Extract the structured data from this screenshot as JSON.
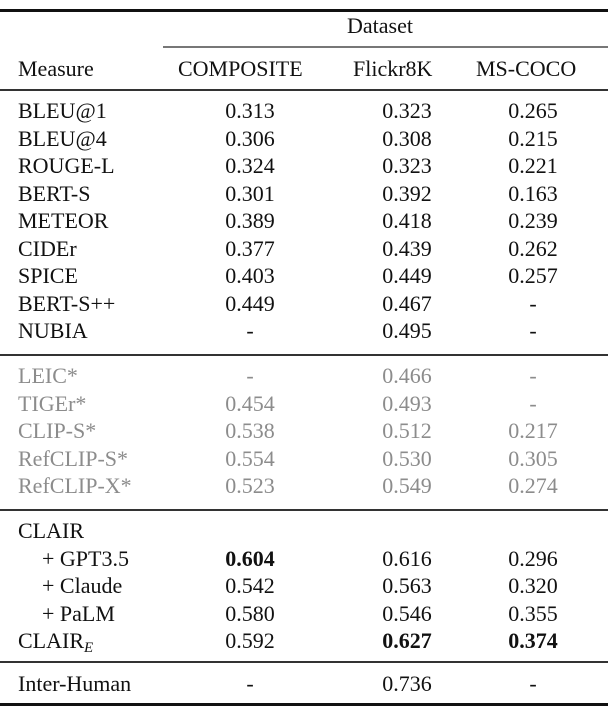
{
  "header": {
    "group_label": "Dataset",
    "measure_label": "Measure",
    "columns": [
      "COMPOSITE",
      "Flickr8K",
      "MS-COCO"
    ]
  },
  "sections": [
    {
      "name": "classic-metrics",
      "style": "normal",
      "rows": [
        {
          "measure": "BLEU@1",
          "values": [
            "0.313",
            "0.323",
            "0.265"
          ]
        },
        {
          "measure": "BLEU@4",
          "values": [
            "0.306",
            "0.308",
            "0.215"
          ]
        },
        {
          "measure": "ROUGE-L",
          "values": [
            "0.324",
            "0.323",
            "0.221"
          ]
        },
        {
          "measure": "BERT-S",
          "values": [
            "0.301",
            "0.392",
            "0.163"
          ]
        },
        {
          "measure": "METEOR",
          "values": [
            "0.389",
            "0.418",
            "0.239"
          ]
        },
        {
          "measure": "CIDEr",
          "values": [
            "0.377",
            "0.439",
            "0.262"
          ]
        },
        {
          "measure": "SPICE",
          "values": [
            "0.403",
            "0.449",
            "0.257"
          ]
        },
        {
          "measure": "BERT-S++",
          "values": [
            "0.449",
            "0.467",
            "-"
          ]
        },
        {
          "measure": "NUBIA",
          "values": [
            "-",
            "0.495",
            "-"
          ]
        }
      ]
    },
    {
      "name": "trained-metrics",
      "style": "gray",
      "rows": [
        {
          "measure": "LEIC*",
          "values": [
            "-",
            "0.466",
            "-"
          ]
        },
        {
          "measure": "TIGEr*",
          "values": [
            "0.454",
            "0.493",
            "-"
          ]
        },
        {
          "measure": "CLIP-S*",
          "values": [
            "0.538",
            "0.512",
            "0.217"
          ]
        },
        {
          "measure": "RefCLIP-S*",
          "values": [
            "0.554",
            "0.530",
            "0.305"
          ]
        },
        {
          "measure": "RefCLIP-X*",
          "values": [
            "0.523",
            "0.549",
            "0.274"
          ]
        }
      ]
    },
    {
      "name": "clair",
      "style": "normal",
      "rows": [
        {
          "measure": "CLAIR",
          "values": [
            "",
            "",
            ""
          ]
        },
        {
          "measure": "+ GPT3.5",
          "indent": true,
          "values": [
            "0.604",
            "0.616",
            "0.296"
          ],
          "bold": [
            true,
            false,
            false
          ]
        },
        {
          "measure": "+ Claude",
          "indent": true,
          "values": [
            "0.542",
            "0.563",
            "0.320"
          ]
        },
        {
          "measure": "+ PaLM",
          "indent": true,
          "values": [
            "0.580",
            "0.546",
            "0.355"
          ]
        },
        {
          "measure": "CLAIR",
          "subscript": "E",
          "values": [
            "0.592",
            "0.627",
            "0.374"
          ],
          "bold": [
            false,
            true,
            true
          ]
        }
      ]
    },
    {
      "name": "human",
      "style": "normal",
      "rows": [
        {
          "measure": "Inter-Human",
          "values": [
            "-",
            "0.736",
            "-"
          ]
        }
      ]
    }
  ],
  "colors": {
    "text": "#111111",
    "gray_text": "#8c8c8c",
    "rule": "#111111"
  }
}
